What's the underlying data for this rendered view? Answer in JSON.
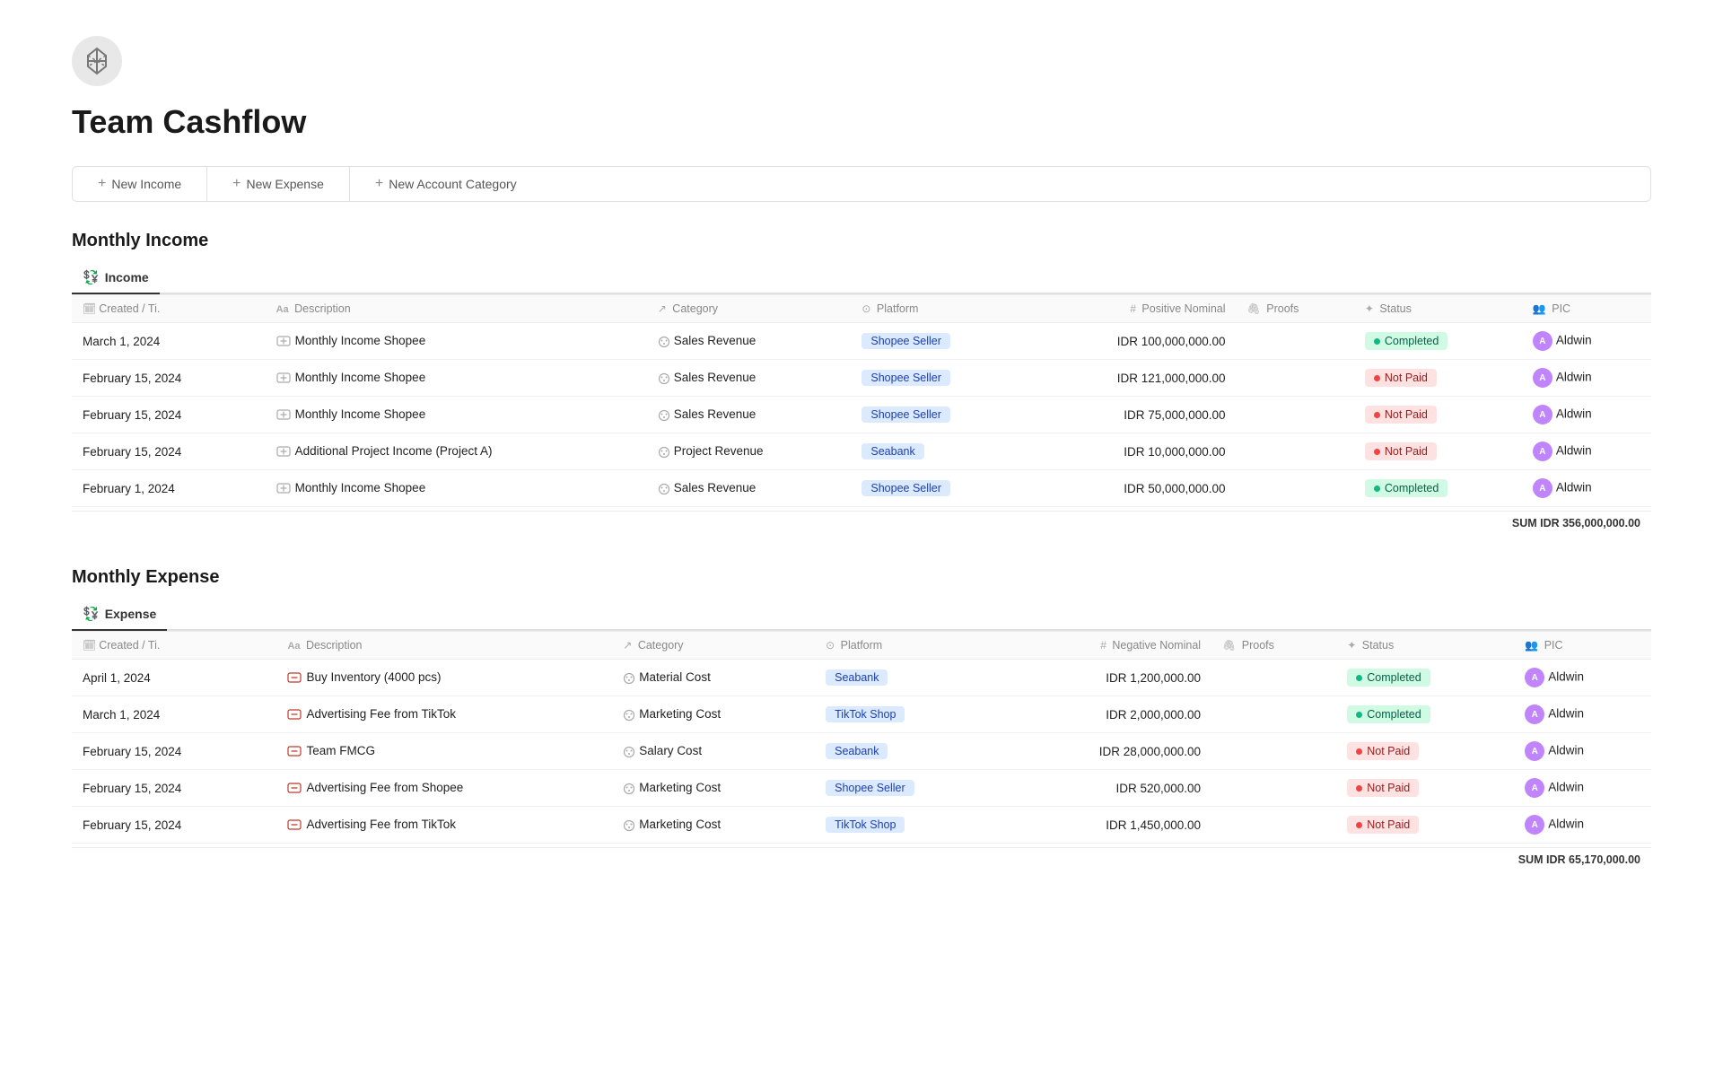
{
  "logo": {
    "alt": "Team Cashflow Logo"
  },
  "page": {
    "title": "Team Cashflow"
  },
  "toolbar": {
    "buttons": [
      {
        "id": "new-income",
        "label": "New Income"
      },
      {
        "id": "new-expense",
        "label": "New Expense"
      },
      {
        "id": "new-account-category",
        "label": "New Account Category"
      }
    ]
  },
  "income_section": {
    "title": "Monthly Income",
    "tab_label": "Income",
    "columns": [
      {
        "key": "created",
        "label": "Created / Ti.",
        "icon": "🗓"
      },
      {
        "key": "description",
        "label": "Description",
        "icon": "Aa"
      },
      {
        "key": "category",
        "label": "Category",
        "icon": "↗"
      },
      {
        "key": "platform",
        "label": "Platform",
        "icon": "⊙"
      },
      {
        "key": "nominal",
        "label": "Positive Nominal",
        "icon": "#"
      },
      {
        "key": "proofs",
        "label": "Proofs",
        "icon": "🖇"
      },
      {
        "key": "status",
        "label": "Status",
        "icon": "✦"
      },
      {
        "key": "pic",
        "label": "PIC",
        "icon": "👥"
      }
    ],
    "rows": [
      {
        "created": "March 1, 2024",
        "description": "Monthly Income Shopee",
        "description_icon": "income",
        "category": "Sales Revenue",
        "platform": "Shopee Seller",
        "platform_type": "shopee",
        "nominal": "IDR 100,000,000.00",
        "proofs": "",
        "status": "Completed",
        "status_type": "completed",
        "pic": "Aldwin"
      },
      {
        "created": "February 15, 2024",
        "description": "Monthly Income Shopee",
        "description_icon": "income",
        "category": "Sales Revenue",
        "platform": "Shopee Seller",
        "platform_type": "shopee",
        "nominal": "IDR 121,000,000.00",
        "proofs": "",
        "status": "Not Paid",
        "status_type": "not-paid",
        "pic": "Aldwin"
      },
      {
        "created": "February 15, 2024",
        "description": "Monthly Income Shopee",
        "description_icon": "income",
        "category": "Sales Revenue",
        "platform": "Shopee Seller",
        "platform_type": "shopee",
        "nominal": "IDR 75,000,000.00",
        "proofs": "",
        "status": "Not Paid",
        "status_type": "not-paid",
        "pic": "Aldwin"
      },
      {
        "created": "February 15, 2024",
        "description": "Additional Project Income (Project A)",
        "description_icon": "income",
        "category": "Project Revenue",
        "platform": "Seabank",
        "platform_type": "seabank",
        "nominal": "IDR 10,000,000.00",
        "proofs": "",
        "status": "Not Paid",
        "status_type": "not-paid",
        "pic": "Aldwin"
      },
      {
        "created": "February 1, 2024",
        "description": "Monthly Income Shopee",
        "description_icon": "income",
        "category": "Sales Revenue",
        "platform": "Shopee Seller",
        "platform_type": "shopee",
        "nominal": "IDR 50,000,000.00",
        "proofs": "",
        "status": "Completed",
        "status_type": "completed",
        "pic": "Aldwin"
      }
    ],
    "sum_label": "SUM",
    "sum_value": "IDR 356,000,000.00"
  },
  "expense_section": {
    "title": "Monthly Expense",
    "tab_label": "Expense",
    "columns": [
      {
        "key": "created",
        "label": "Created / Ti.",
        "icon": "🗓"
      },
      {
        "key": "description",
        "label": "Description",
        "icon": "Aa"
      },
      {
        "key": "category",
        "label": "Category",
        "icon": "↗"
      },
      {
        "key": "platform",
        "label": "Platform",
        "icon": "⊙"
      },
      {
        "key": "nominal",
        "label": "Negative Nominal",
        "icon": "#"
      },
      {
        "key": "proofs",
        "label": "Proofs",
        "icon": "🖇"
      },
      {
        "key": "status",
        "label": "Status",
        "icon": "✦"
      },
      {
        "key": "pic",
        "label": "PIC",
        "icon": "👥"
      }
    ],
    "rows": [
      {
        "created": "April 1, 2024",
        "description": "Buy Inventory (4000 pcs)",
        "description_icon": "expense",
        "category": "Material Cost",
        "platform": "Seabank",
        "platform_type": "seabank",
        "nominal": "IDR 1,200,000.00",
        "proofs": "",
        "status": "Completed",
        "status_type": "completed",
        "pic": "Aldwin"
      },
      {
        "created": "March 1, 2024",
        "description": "Advertising Fee from TikTok",
        "description_icon": "expense",
        "category": "Marketing Cost",
        "platform": "TikTok Shop",
        "platform_type": "tiktok",
        "nominal": "IDR 2,000,000.00",
        "proofs": "",
        "status": "Completed",
        "status_type": "completed",
        "pic": "Aldwin"
      },
      {
        "created": "February 15, 2024",
        "description": "Team FMCG",
        "description_icon": "expense",
        "category": "Salary Cost",
        "platform": "Seabank",
        "platform_type": "seabank",
        "nominal": "IDR 28,000,000.00",
        "proofs": "",
        "status": "Not Paid",
        "status_type": "not-paid",
        "pic": "Aldwin"
      },
      {
        "created": "February 15, 2024",
        "description": "Advertising Fee from Shopee",
        "description_icon": "expense",
        "category": "Marketing Cost",
        "platform": "Shopee Seller",
        "platform_type": "shopee",
        "nominal": "IDR 520,000.00",
        "proofs": "",
        "status": "Not Paid",
        "status_type": "not-paid",
        "pic": "Aldwin"
      },
      {
        "created": "February 15, 2024",
        "description": "Advertising Fee from TikTok",
        "description_icon": "expense",
        "category": "Marketing Cost",
        "platform": "TikTok Shop",
        "platform_type": "tiktok",
        "nominal": "IDR 1,450,000.00",
        "proofs": "",
        "status": "Not Paid",
        "status_type": "not-paid",
        "pic": "Aldwin"
      }
    ],
    "sum_label": "SUM",
    "sum_value": "IDR 65,170,000.00"
  }
}
